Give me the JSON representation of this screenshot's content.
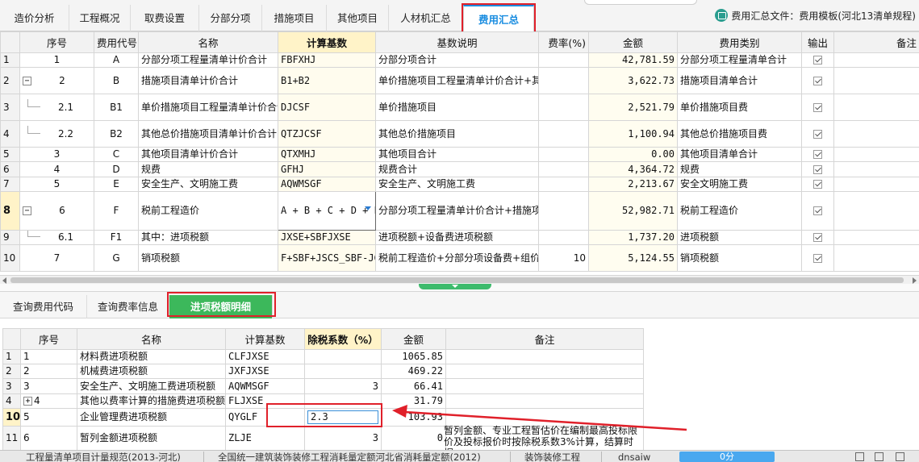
{
  "top_tabs": [
    {
      "label": "造价分析"
    },
    {
      "label": "工程概况"
    },
    {
      "label": "取费设置"
    },
    {
      "label": "分部分项"
    },
    {
      "label": "措施项目"
    },
    {
      "label": "其他项目"
    },
    {
      "label": "人材机汇总"
    },
    {
      "label": "费用汇总"
    }
  ],
  "active_top_tab": "费用汇总",
  "template_file_text": "费用汇总文件：费用模板(河北13清单规程)",
  "icons": {
    "template_file": "book-icon",
    "expand": "expand-icon",
    "collapse": "collapse-icon",
    "checkbox": "checkbox-checked-icon",
    "dropdown": "dropdown-arrow-icon"
  },
  "main_table": {
    "headers": [
      "",
      "序号",
      "费用代号",
      "名称",
      "计算基数",
      "基数说明",
      "费率(%)",
      "金额",
      "费用类别",
      "输出",
      "备注"
    ],
    "rows": [
      {
        "rn": "1",
        "seq": "1",
        "code": "A",
        "name": "分部分项工程量清单计价合计",
        "base": "FBFXHJ",
        "desc": "分部分项合计",
        "rate": "",
        "amount": "42,781.59",
        "category": "分部分项工程量清单合计",
        "output": true,
        "tree": "none"
      },
      {
        "rn": "2",
        "seq": "2",
        "code": "B",
        "name": "措施项目清单计价合计",
        "base": "B1+B2",
        "desc": "单价措施项目工程量清单计价合计+其他总价措施项目清单计价合计",
        "rate": "",
        "amount": "3,622.73",
        "category": "措施项目清单合计",
        "output": true,
        "tree": "collapse"
      },
      {
        "rn": "3",
        "seq": "2.1",
        "code": "B1",
        "name": "单价措施项目工程量清单计价合计",
        "base": "DJCSF",
        "desc": "单价措施项目",
        "rate": "",
        "amount": "2,521.79",
        "category": "单价措施项目费",
        "output": true,
        "tree": "child"
      },
      {
        "rn": "4",
        "seq": "2.2",
        "code": "B2",
        "name": "其他总价措施项目清单计价合计",
        "base": "QTZJCSF",
        "desc": "其他总价措施项目",
        "rate": "",
        "amount": "1,100.94",
        "category": "其他总价措施项目费",
        "output": true,
        "tree": "child"
      },
      {
        "rn": "5",
        "seq": "3",
        "code": "C",
        "name": "其他项目清单计价合计",
        "base": "QTXMHJ",
        "desc": "其他项目合计",
        "rate": "",
        "amount": "0.00",
        "category": "其他项目清单合计",
        "output": true,
        "tree": "none"
      },
      {
        "rn": "6",
        "seq": "4",
        "code": "D",
        "name": "规费",
        "base": "GFHJ",
        "desc": "规费合计",
        "rate": "",
        "amount": "4,364.72",
        "category": "规费",
        "output": true,
        "tree": "none"
      },
      {
        "rn": "7",
        "seq": "5",
        "code": "E",
        "name": "安全生产、文明施工费",
        "base": "AQWMSGF",
        "desc": "安全生产、文明施工费",
        "rate": "",
        "amount": "2,213.67",
        "category": "安全文明施工费",
        "output": true,
        "tree": "none"
      },
      {
        "rn": "8",
        "seq": "6",
        "code": "F",
        "name": "税前工程造价",
        "base": "A + B + C + D + E",
        "desc": "分部分项工程量清单计价合计+措施项目清单计价合计+其他项目清单计价合计+规费+安全生产、文明施工费",
        "rate": "",
        "amount": "52,982.71",
        "category": "税前工程造价",
        "output": true,
        "tree": "collapse",
        "selected": true
      },
      {
        "rn": "9",
        "seq": "6.1",
        "code": "F1",
        "name": "其中：进项税额",
        "base": "JXSE+SBFJXSE",
        "desc": "进项税额+设备费进项税额",
        "rate": "",
        "amount": "1,737.20",
        "category": "进项税额",
        "output": true,
        "tree": "child"
      },
      {
        "rn": "10",
        "seq": "7",
        "code": "G",
        "name": "销项税额",
        "base": "F+SBF+JSCS_SBF-JGCLF-JGZCF-JGSBF-",
        "desc": "税前工程造价+分部分项设备费+组价措施项目设备费-甲供材料费-甲供主",
        "rate": "10",
        "amount": "5,124.55",
        "category": "销项税额",
        "output": true,
        "tree": "none"
      }
    ]
  },
  "bottom_tabs": [
    {
      "label": "查询费用代码"
    },
    {
      "label": "查询费率信息"
    },
    {
      "label": "进项税额明细"
    }
  ],
  "active_bottom_tab": "进项税额明细",
  "detail_table": {
    "headers": [
      "",
      "序号",
      "名称",
      "计算基数",
      "除税系数（%）",
      "金额",
      "备注"
    ],
    "rows": [
      {
        "rn": "1",
        "seq": "1",
        "name": "材料费进项税额",
        "base": "CLFJXSE",
        "coef": "",
        "amount": "1065.85",
        "remark": ""
      },
      {
        "rn": "2",
        "seq": "2",
        "name": "机械费进项税额",
        "base": "JXFJXSE",
        "coef": "",
        "amount": "469.22",
        "remark": ""
      },
      {
        "rn": "3",
        "seq": "3",
        "name": "安全生产、文明施工费进项税额",
        "base": "AQWMSGF",
        "coef": "3",
        "amount": "66.41",
        "remark": ""
      },
      {
        "rn": "4",
        "seq": "4",
        "name": "其他以费率计算的措施费进项税额",
        "base": "FLJXSE",
        "coef": "",
        "amount": "31.79",
        "remark": "",
        "expand": true
      },
      {
        "rn": "10",
        "seq": "5",
        "name": "企业管理费进项税额",
        "base": "QYGLF",
        "coef": "2.3",
        "amount": "103.93",
        "remark": "",
        "selected": true,
        "editing": true
      },
      {
        "rn": "11",
        "seq": "6",
        "name": "暂列金额进项税额",
        "base": "ZLJE",
        "coef": "3",
        "amount": "0",
        "remark": "暂列金额、专业工程暂估价在编制最高投标限价及投标报价时按除税系数3%计算，结算时据"
      }
    ]
  },
  "status_bar": {
    "items": [
      "工程量清单项目计量规范(2013-河北)",
      "全国统一建筑装饰装修工程消耗量定额河北省消耗量定额(2012)",
      "装饰装修工程",
      "dnsaiw"
    ],
    "button": "0分"
  }
}
